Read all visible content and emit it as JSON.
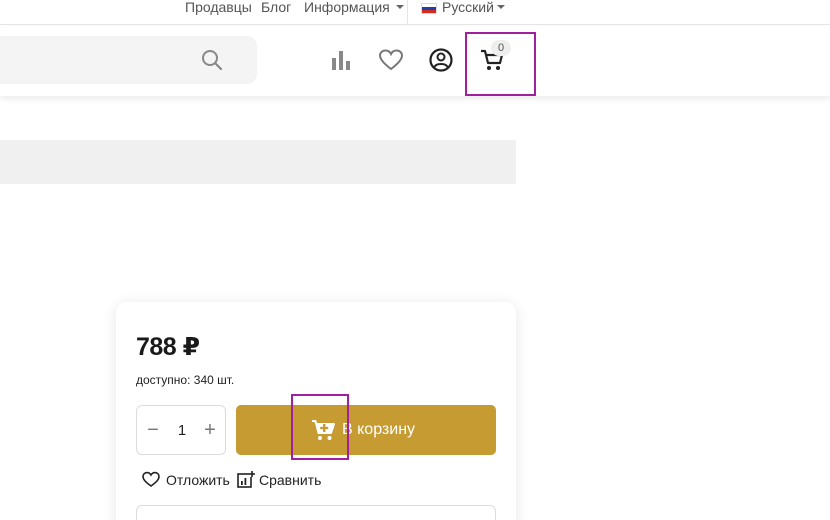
{
  "topbar": {
    "sellers": "Продавцы",
    "blog": "Блог",
    "info": "Информация",
    "language": "Русский"
  },
  "header": {
    "search_placeholder": "",
    "cart_count": "0",
    "icons": [
      "search-icon",
      "compare-chart-icon",
      "heart-icon",
      "user-circle-icon",
      "cart-icon"
    ]
  },
  "product": {
    "price": "788 ₽",
    "availability": "доступно: 340 шт.",
    "quantity": "1",
    "qty_minus": "−",
    "qty_plus": "+",
    "add_to_cart": "В корзину",
    "save_later": "Отложить",
    "compare": "Сравнить"
  },
  "colors": {
    "accent": "#c59b32",
    "annotation": "#a020a0"
  }
}
